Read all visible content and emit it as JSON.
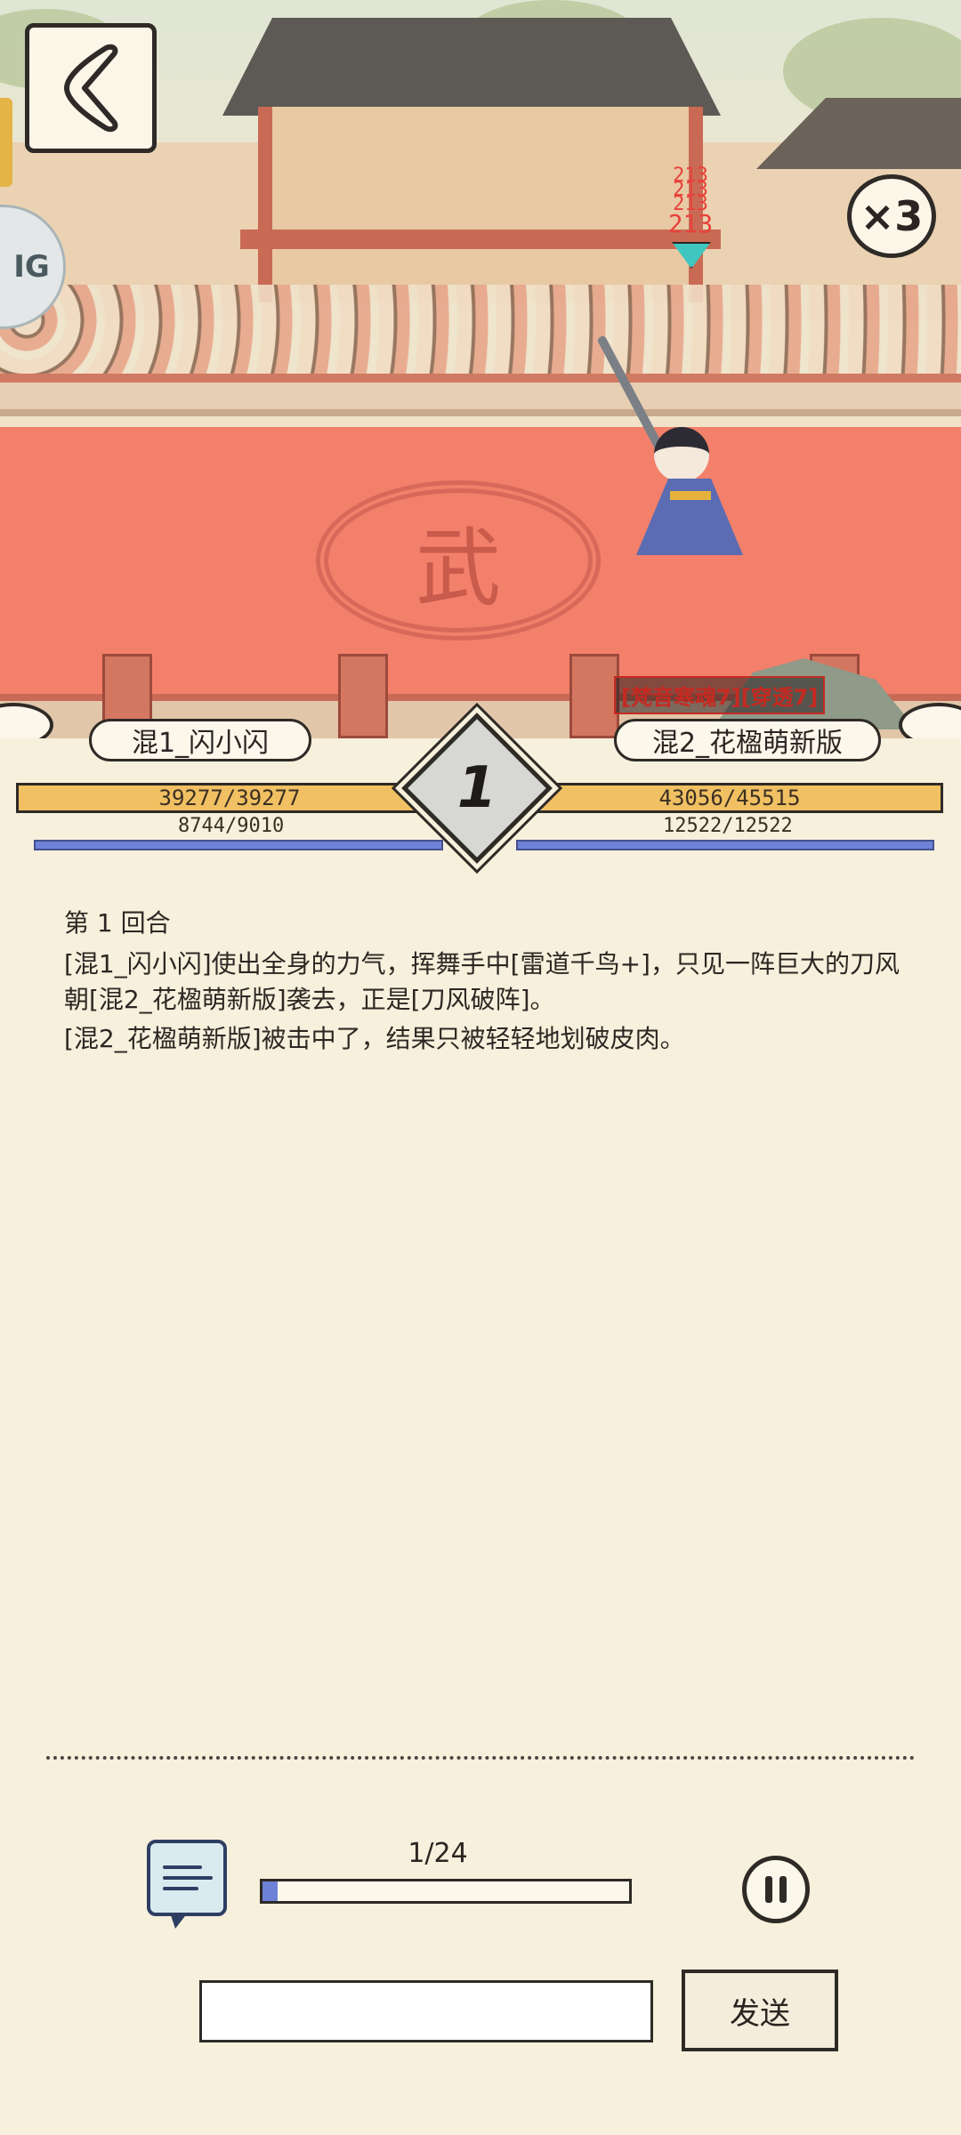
{
  "controls": {
    "back_icon": "chevron-left",
    "speed_label": "×3",
    "edge_icon_label": "IG"
  },
  "effects": {
    "damage_numbers": [
      "213",
      "213",
      "213",
      "213"
    ],
    "buff_text": "[梵音寒魂7][穿透7]"
  },
  "arena": {
    "emblem": "武"
  },
  "player1": {
    "name": "混1_闪小闪",
    "hp": "39277/39277",
    "hp_fraction": 1.0,
    "mp": "8744/9010",
    "mp_fraction": 0.97
  },
  "player2": {
    "name": "混2_花楹萌新版",
    "hp": "43056/45515",
    "hp_fraction": 0.946,
    "mp": "12522/12522",
    "mp_fraction": 1.0
  },
  "round": {
    "number": "1"
  },
  "log": {
    "title": "第 1 回合",
    "lines": [
      "[混1_闪小闪]使出全身的力气，挥舞手中[雷道千鸟+]，只见一阵巨大的刀风朝[混2_花楹萌新版]袭去，正是[刀风破阵]。",
      "[混2_花楹萌新版]被击中了，结果只被轻轻地划破皮肉。"
    ]
  },
  "playback": {
    "progress_text": "1/24",
    "progress_fraction": 0.042,
    "chat_icon": "chat-icon",
    "pause_icon": "pause-icon"
  },
  "chat": {
    "input_value": "",
    "input_placeholder": "",
    "send_label": "发送"
  }
}
